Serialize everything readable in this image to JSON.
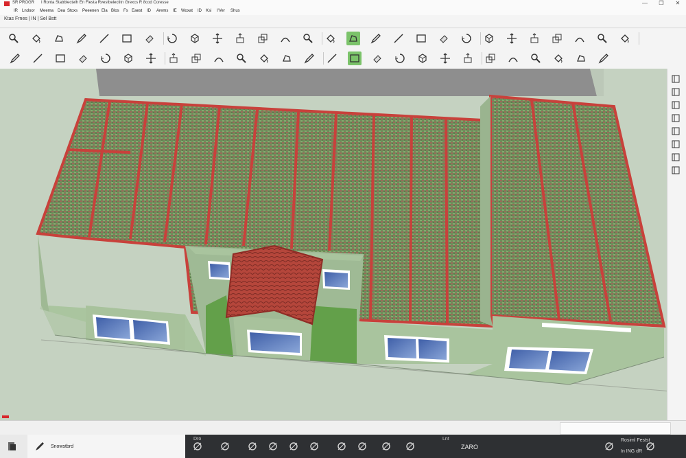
{
  "titlebar": {
    "left_text": "SR PROGR",
    "center_text": "I Ronta Stabblectelh En Fiesta Rvestbelectitn Grexcs R 8cod Coresse",
    "win_controls": [
      "—",
      "❐",
      "✕"
    ]
  },
  "menubar": {
    "items": [
      "IR",
      "Lndoor",
      "Meema",
      "Dea",
      "Stoxs",
      "Peeenen",
      "Ela",
      "Blos",
      "Fs",
      "Eaest",
      "ID",
      "Arems",
      "IE",
      "Woxat",
      "ID",
      "Ksi",
      "I'Ver",
      "Shus"
    ]
  },
  "inforow": {
    "text": "Ktas Frnes | IN | Sel Bstt"
  },
  "toolbar1": {
    "icons": [
      "search-icon",
      "paint-bucket-icon",
      "shape-icon",
      "pencil-icon",
      "line-icon",
      "rectangle-icon",
      "eraser-icon",
      "rotate-icon",
      "cube-icon",
      "move-icon",
      "push-pull-icon",
      "scale-icon",
      "follow-me-icon",
      "section-icon",
      "measure-icon",
      "select-tool-icon",
      "orbit-icon",
      "pan-icon",
      "zoom-icon",
      "zoom-extents-icon",
      "cross-icon",
      "components-icon",
      "camera-icon",
      "wall-icon",
      "door-icon",
      "window-icon",
      "roof-icon",
      "brush-icon"
    ],
    "active": "select-tool-icon"
  },
  "toolbar2": {
    "icons": [
      "pencil-icon",
      "slash-icon",
      "square-icon",
      "circle-icon",
      "arc-icon",
      "tape-icon",
      "curve-icon",
      "offset-icon",
      "box-icon",
      "cone-icon",
      "intersect-icon",
      "shape-icon",
      "arrow-icon",
      "scissors-icon",
      "texture-icon",
      "walk-icon",
      "look-icon",
      "position-camera-icon",
      "crop-icon",
      "cross-icon",
      "clock-icon",
      "material-icon",
      "sandbox-icon",
      "layer-icon",
      "tag-icon",
      "folder-icon",
      "export-icon"
    ],
    "active": "walk-icon"
  },
  "status": {
    "left_label": "Snowstbrd",
    "tab_label": "Dro",
    "measure_label": "Lnt",
    "measure_value": "ZARO",
    "right_label": "Rosiml Festst",
    "right_value": "In ING dR"
  },
  "colors": {
    "roof_tiles": "#6f8a5a",
    "roof_trim": "#c8413b",
    "wall": "#a9c49e",
    "ground": "#c5d2c1",
    "active_tool": "#7bc36a",
    "bottom_bar": "#2e3033"
  }
}
